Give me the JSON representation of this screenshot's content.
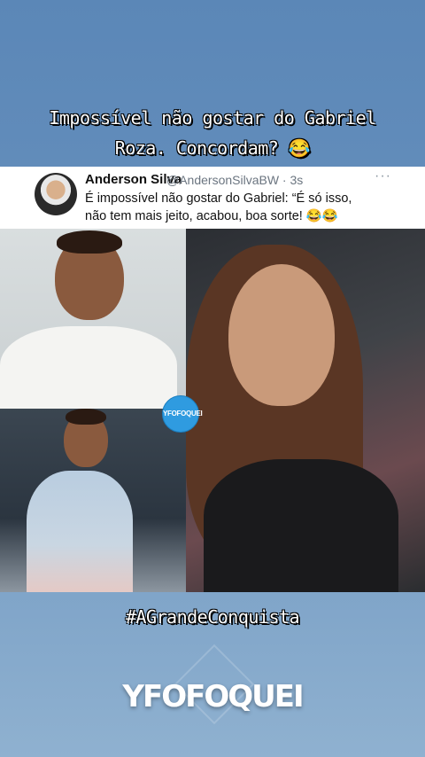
{
  "headline": {
    "line1": "Impossível não gostar do Gabriel",
    "line2": "Roza. Concordam? 😂"
  },
  "tweet": {
    "name": "Anderson Silva",
    "handle_time": "@AndersonSilvaBW · 3s",
    "more": "···",
    "text_line1": "É impossível não gostar do Gabriel: “É só isso,",
    "text_line2": "não tem mais jeito, acabou, boa sorte! 😂😂"
  },
  "badge": "YFOFOQUEI",
  "hashtag": "#AGrandeConquista",
  "brand": "YFOFOQUEI",
  "colors": {
    "background": "#6790bd",
    "badge": "#2f9be0"
  }
}
